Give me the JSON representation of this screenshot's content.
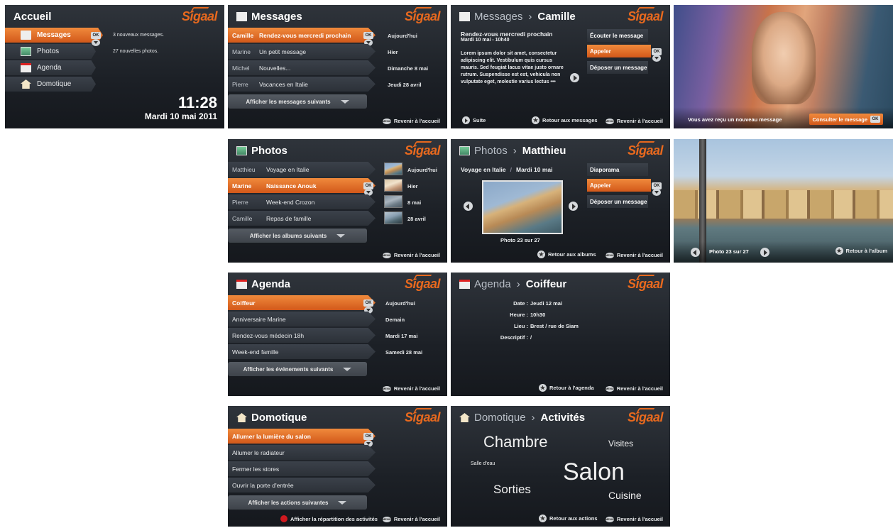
{
  "colors": {
    "accent": "#e8691e",
    "bg": "#1f2329",
    "row": "#353a42"
  },
  "logo": "Sigaal",
  "common": {
    "ok": "OK",
    "menu": "MENU",
    "home": "Revenir à l'accueil"
  },
  "accueil": {
    "title": "Accueil",
    "items": [
      {
        "label": "Messages",
        "info": "3 nouveaux messages."
      },
      {
        "label": "Photos",
        "info": "27 nouvelles photos."
      },
      {
        "label": "Agenda"
      },
      {
        "label": "Domotique"
      }
    ],
    "time": "11:28",
    "date": "Mardi 10 mai 2011"
  },
  "messages": {
    "title": "Messages",
    "rows": [
      {
        "name": "Camille",
        "subject": "Rendez-vous mercredi prochain",
        "date": "Aujourd'hui"
      },
      {
        "name": "Marine",
        "subject": "Un petit message",
        "date": "Hier"
      },
      {
        "name": "Michel",
        "subject": "Nouvelles...",
        "date": "Dimanche 8 mai"
      },
      {
        "name": "Pierre",
        "subject": "Vacances en Italie",
        "date": "Jeudi 28 avril"
      }
    ],
    "more": "Afficher les messages suivants"
  },
  "message_detail": {
    "title": "Messages",
    "sub": "Camille",
    "subject": "Rendez-vous mercredi prochain",
    "date": "Mardi 10 mai - 10h40",
    "body": "Lorem ipsum dolor sit amet, consectetur adipiscing elit. Vestibulum quis cursus mauris. Sed feugiat lacus vitae justo ornare rutrum. Suspendisse est est, vehicula non vulputate eget, molestie varius lectus •••",
    "actions": [
      "Écouter le message",
      "Appeler",
      "Déposer un message"
    ],
    "next": "Suite",
    "back": "Retour aux messages"
  },
  "incoming": {
    "text": "Vous avez reçu un nouveau message",
    "button": "Consulter le message"
  },
  "photos": {
    "title": "Photos",
    "rows": [
      {
        "name": "Matthieu",
        "album": "Voyage en Italie",
        "date": "Aujourd'hui"
      },
      {
        "name": "Marine",
        "album": "Naissance Anouk",
        "date": "Hier"
      },
      {
        "name": "Pierre",
        "album": "Week-end Crozon",
        "date": "8 mai"
      },
      {
        "name": "Camille",
        "album": "Repas de famille",
        "date": "28 avril"
      }
    ],
    "more": "Afficher les albums suivants"
  },
  "photo_detail": {
    "title": "Photos",
    "sub": "Matthieu",
    "album": "Voyage en Italie",
    "date": "Mardi 10 mai",
    "counter": "Photo 23 sur 27",
    "actions": [
      "Diaporama",
      "Appeler",
      "Déposer un message"
    ],
    "back": "Retour aux albums"
  },
  "slideshow": {
    "counter": "Photo 23 sur 27",
    "back": "Retour à l'album"
  },
  "agenda": {
    "title": "Agenda",
    "rows": [
      {
        "label": "Coiffeur",
        "date": "Aujourd'hui"
      },
      {
        "label": "Anniversaire Marine",
        "date": "Demain"
      },
      {
        "label": "Rendez-vous médecin 18h",
        "date": "Mardi 17 mai"
      },
      {
        "label": "Week-end famille",
        "date": "Samedi 28 mai"
      }
    ],
    "more": "Afficher les événements suivants"
  },
  "agenda_detail": {
    "title": "Agenda",
    "sub": "Coiffeur",
    "fields": [
      {
        "label": "Date :",
        "value": "Jeudi 12 mai"
      },
      {
        "label": "Heure :",
        "value": "10h30"
      },
      {
        "label": "Lieu :",
        "value": "Brest / rue de Siam"
      },
      {
        "label": "Descriptif :",
        "value": "/"
      }
    ],
    "back": "Retour à l'agenda"
  },
  "domotique": {
    "title": "Domotique",
    "rows": [
      "Allumer la lumière du salon",
      "Allumer le radiateur",
      "Fermer les stores",
      "Ouvrir la porte d'entrée"
    ],
    "more": "Afficher les actions suivantes",
    "repartition": "Afficher la répartition des activités"
  },
  "activites": {
    "title": "Domotique",
    "sub": "Activités",
    "words": [
      "Chambre",
      "Visites",
      "Salle d'eau",
      "Salon",
      "Sorties",
      "Cuisine"
    ],
    "back": "Retour aux actions"
  }
}
